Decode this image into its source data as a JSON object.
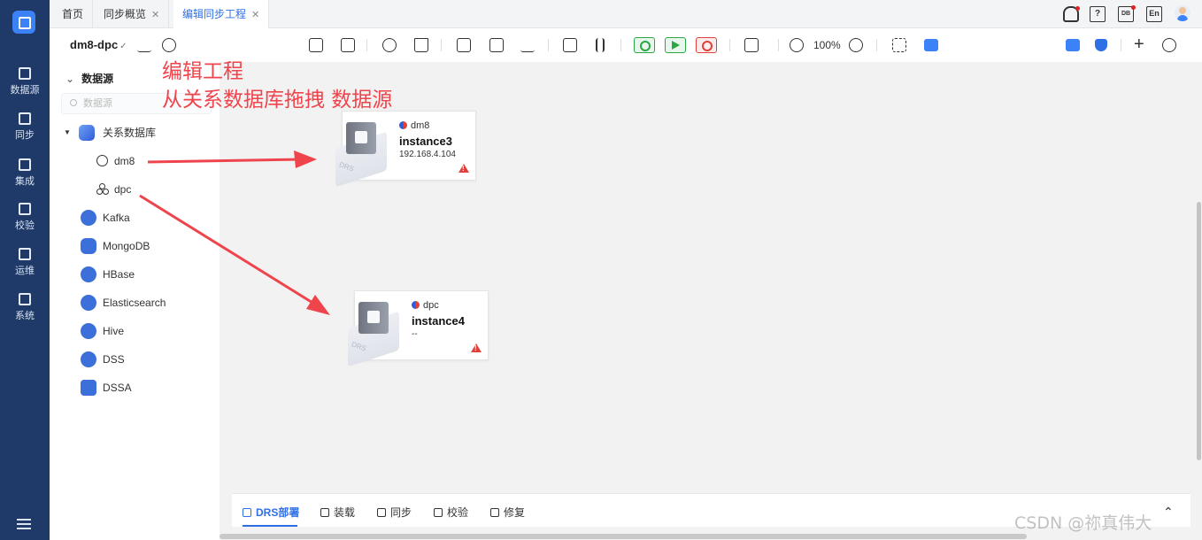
{
  "sidebar": {
    "items": [
      {
        "label": "数据源",
        "icon": "datasource-icon"
      },
      {
        "label": "同步",
        "icon": "sync-icon"
      },
      {
        "label": "集成",
        "icon": "integration-icon"
      },
      {
        "label": "校验",
        "icon": "check-icon"
      },
      {
        "label": "运维",
        "icon": "ops-icon"
      },
      {
        "label": "系统",
        "icon": "system-icon"
      }
    ]
  },
  "tabs": [
    {
      "label": "首页",
      "closable": false
    },
    {
      "label": "同步概览",
      "closable": true
    },
    {
      "label": "编辑同步工程",
      "closable": true,
      "active": true
    }
  ],
  "header_icons": {
    "lang": "En",
    "help": "?",
    "doc": "DB"
  },
  "toolbar": {
    "project": "dm8-dpc",
    "zoom": "100%",
    "accent": "#2f6fe6"
  },
  "left_panel": {
    "title": "数据源",
    "search_placeholder": "数据源",
    "groups": [
      {
        "label": "关系数据库",
        "children": [
          "dm8",
          "dpc"
        ]
      },
      {
        "label": "Kafka"
      },
      {
        "label": "MongoDB"
      },
      {
        "label": "HBase"
      },
      {
        "label": "Elasticsearch"
      },
      {
        "label": "Hive"
      },
      {
        "label": "DSS"
      },
      {
        "label": "DSSA"
      }
    ]
  },
  "annotation": {
    "line1": "编辑工程",
    "line2": "从关系数据库拖拽 数据源",
    "color": "#f0444c"
  },
  "nodes": [
    {
      "db": "dm8",
      "instance": "instance3",
      "address": "192.168.4.104",
      "cube_label": "DRS"
    },
    {
      "db": "dpc",
      "instance": "instance4",
      "address": "--",
      "cube_label": "DRS"
    }
  ],
  "bottom_tabs": [
    {
      "label": "DRS部署",
      "active": true
    },
    {
      "label": "装载"
    },
    {
      "label": "同步"
    },
    {
      "label": "校验"
    },
    {
      "label": "修复"
    }
  ],
  "watermark": "CSDN @祢真伟大"
}
